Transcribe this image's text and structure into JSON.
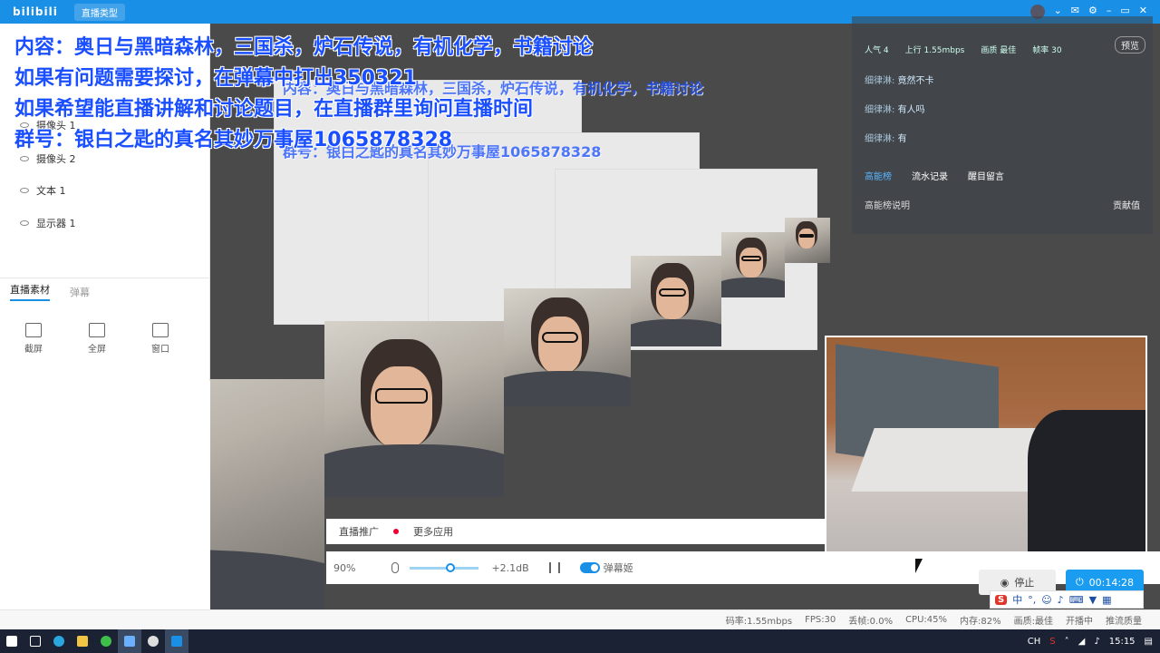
{
  "titlebar": {
    "logo": "bilibili",
    "back_label": "直播类型"
  },
  "sources": [
    "摄像头 1",
    "摄像头 2",
    "文本 1",
    "显示器 1"
  ],
  "tabs": {
    "material": "直播素材",
    "danmu": "弹幕"
  },
  "tools": [
    "截屏",
    "全屏",
    "窗口"
  ],
  "app_row": {
    "promo": "直播推广",
    "more_apps": "更多应用"
  },
  "controls": {
    "volume_pct": "90%",
    "gain": "+2.1dB",
    "danmu_machine": "弹幕姬"
  },
  "buttons": {
    "stop": "停止",
    "timer": "00:14:28"
  },
  "ime_label": "中",
  "status": {
    "bitrate": "码率:1.55mbps",
    "fps": "FPS:30",
    "drop": "丢帧:0.0%",
    "cpu": "CPU:45%",
    "mem": "内存:82%",
    "quality": "画质:最佳",
    "live": "开播中",
    "push": "推流质量"
  },
  "overlay": {
    "line1": "内容：奥日与黑暗森林，三国杀，炉石传说，有机化学，书籍讨论",
    "line2": "如果有问题需要探讨，在弹幕中打出350321",
    "line3": "如果希望能直播讲解和讨论题目，在直播群里询问直播时间",
    "line4": "群号：银白之匙的真名其妙万事屋1065878328"
  },
  "danmu_panel": {
    "top": [
      "人气 4",
      "上行 1.55mbps",
      "画质 最佳",
      "帧率 30"
    ],
    "preview": "预览",
    "messages": [
      {
        "user": "细律淋:",
        "text": "竟然不卡"
      },
      {
        "user": "细律淋:",
        "text": "有人吗"
      },
      {
        "user": "细律淋:",
        "text": "有"
      }
    ],
    "tabs": [
      "高能榜",
      "流水记录",
      "醒目留言"
    ],
    "sub": "高能榜说明",
    "gift": "贡献值"
  },
  "taskbar": {
    "time": "15:15",
    "lang": "CH"
  }
}
